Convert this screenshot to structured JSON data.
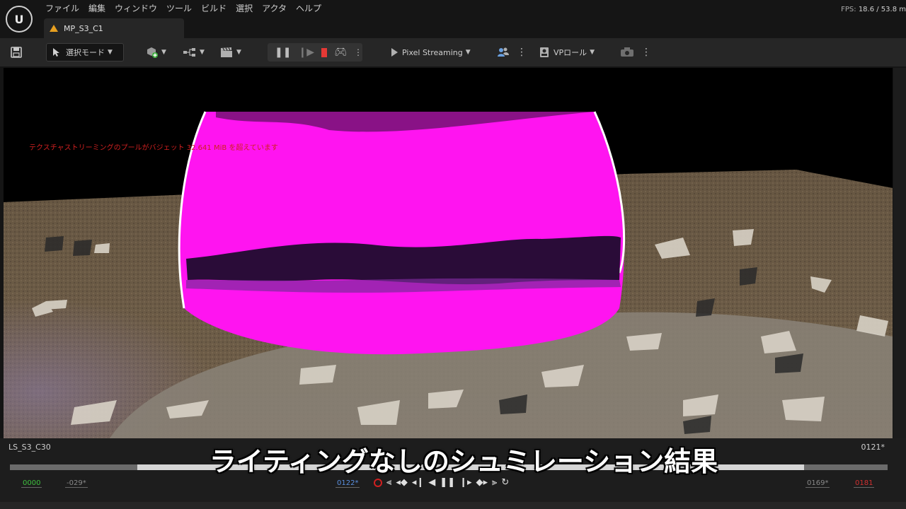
{
  "menu": {
    "logo_text": "U",
    "items": [
      "ファイル",
      "編集",
      "ウィンドウ",
      "ツール",
      "ビルド",
      "選択",
      "アクタ",
      "ヘルプ"
    ],
    "fps_label": "FPS:",
    "fps_value": "18.6 / 53.8 m"
  },
  "tab": {
    "level_name": "MP_S3_C1"
  },
  "toolbar": {
    "save_icon": "save-icon",
    "select_mode": "選択モード",
    "pixel_streaming": "Pixel Streaming",
    "vp_role": "VPロール"
  },
  "viewport": {
    "warning_text": "テクスチャストリーミングのプールがバジェット 32.641 MiB を超えています",
    "colors": {
      "magenta": "#ff14f0",
      "ground": "#6b5a44",
      "warning": "#d02020"
    }
  },
  "sequencer": {
    "sequence_name": "LS_S3_C30",
    "current_frame_top": "0121*",
    "start_frame": "0000",
    "in_frame": "-029*",
    "current_frame": "0122*",
    "out_frame": "0169*",
    "end_frame": "0181",
    "playhead_fraction": 0.145,
    "range_end_fraction": 0.905
  },
  "subtitle": "ライティングなしのシュミレーション結果"
}
